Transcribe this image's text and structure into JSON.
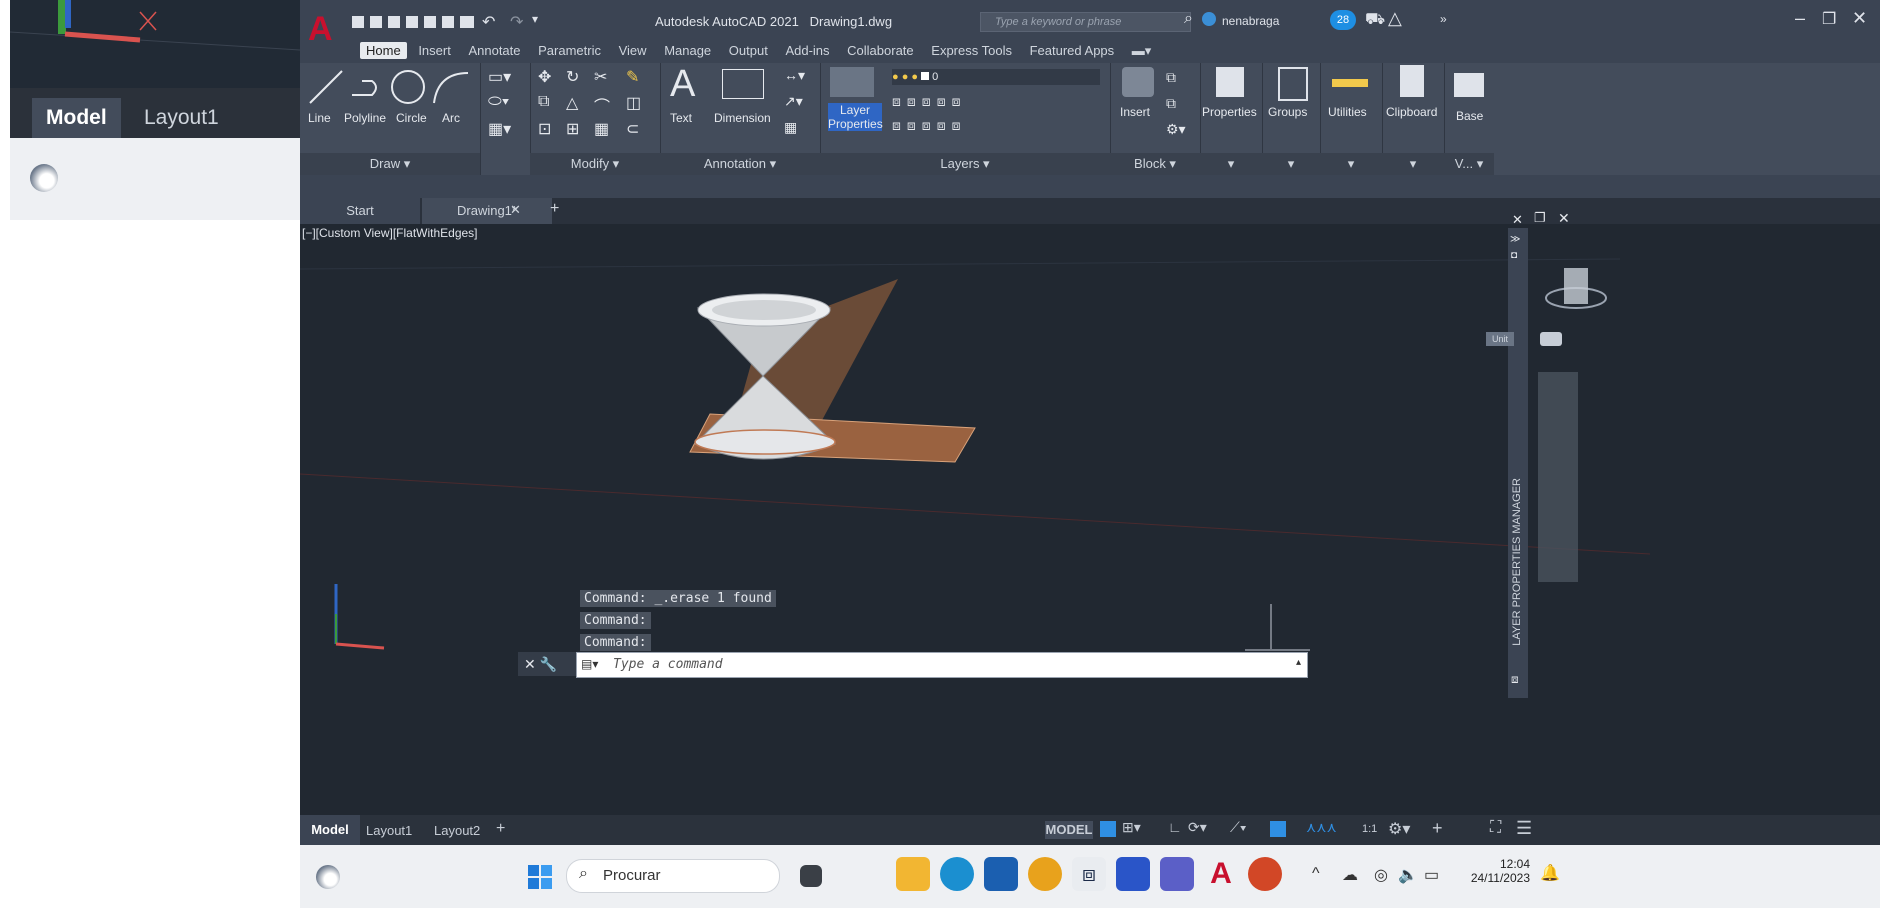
{
  "left_strip": {
    "tabs": [
      {
        "label": "Model"
      },
      {
        "label": "Layout1"
      }
    ]
  },
  "titlebar": {
    "title": "Autodesk AutoCAD 2021",
    "filename": "Drawing1.dwg",
    "search_placeholder": "Type a keyword or phrase",
    "user": "nenabraga",
    "badge_count": "28"
  },
  "ribbon_tabs": [
    {
      "label": "Home",
      "active": true
    },
    {
      "label": "Insert"
    },
    {
      "label": "Annotate"
    },
    {
      "label": "Parametric"
    },
    {
      "label": "View"
    },
    {
      "label": "Manage"
    },
    {
      "label": "Output"
    },
    {
      "label": "Add-ins"
    },
    {
      "label": "Collaborate"
    },
    {
      "label": "Express Tools"
    },
    {
      "label": "Featured Apps"
    }
  ],
  "ribbon": {
    "draw": {
      "title": "Draw ▾",
      "line": "Line",
      "polyline": "Polyline",
      "circle": "Circle",
      "arc": "Arc"
    },
    "modify": {
      "title": "Modify ▾"
    },
    "annotation": {
      "title": "Annotation ▾",
      "text": "Text",
      "dimension": "Dimension"
    },
    "layers": {
      "title": "Layers ▾",
      "layer_properties": "Layer Properties",
      "layer_value": "0"
    },
    "block": {
      "title": "Block ▾",
      "insert": "Insert"
    },
    "properties": "Properties",
    "groups": "Groups",
    "utilities": "Utilities",
    "clipboard": "Clipboard",
    "base": "Base",
    "view_short": "V... ▾"
  },
  "doc_tabs": {
    "start": "Start",
    "drawing": "Drawing1*"
  },
  "viewport": {
    "view_label": "[−][Custom View][FlatWithEdges]",
    "command_history": [
      "Command: _.erase 1 found",
      "Command:",
      "Command:"
    ],
    "command_placeholder": "Type a command",
    "layer_manager_label": "LAYER PROPERTIES MANAGER",
    "navcube_label": "Unit"
  },
  "statusbar": {
    "tabs": [
      {
        "label": "Model"
      },
      {
        "label": "Layout1"
      },
      {
        "label": "Layout2"
      }
    ],
    "mode": "MODEL",
    "scale": "1:1"
  },
  "taskbar": {
    "search_placeholder": "Procurar",
    "time": "12:04",
    "date": "24/11/2023"
  },
  "colors": {
    "accent_red": "#c8102e",
    "viewport_bg": "#212831",
    "ribbon_bg": "#434c5b",
    "plane_orange": "#b07050"
  }
}
